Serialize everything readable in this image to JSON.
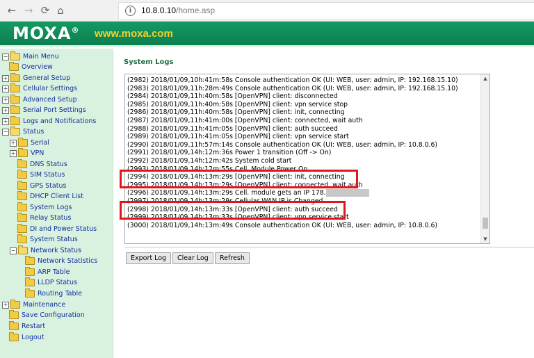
{
  "browser": {
    "back_icon": "←",
    "forward_icon": "→",
    "reload_icon": "⟳",
    "home_icon": "⌂",
    "info_icon": "i",
    "url_host": "10.8.0.10",
    "url_path": "/home.asp"
  },
  "header": {
    "logo": "MOXA",
    "logo_mark": "®",
    "site": "www.moxa.com"
  },
  "sidebar": {
    "items": [
      {
        "label": "Main Menu",
        "expander": "−"
      },
      {
        "label": "Overview",
        "expander": ""
      },
      {
        "label": "General Setup",
        "expander": "+"
      },
      {
        "label": "Cellular Settings",
        "expander": "+"
      },
      {
        "label": "Advanced Setup",
        "expander": "+"
      },
      {
        "label": "Serial Port Settings",
        "expander": "+"
      },
      {
        "label": "Logs and Notifications",
        "expander": "+"
      },
      {
        "label": "Status",
        "expander": "−"
      },
      {
        "label": "Serial",
        "expander": "+"
      },
      {
        "label": "VPN",
        "expander": "+"
      },
      {
        "label": "DNS Status",
        "expander": ""
      },
      {
        "label": "SIM Status",
        "expander": ""
      },
      {
        "label": "GPS Status",
        "expander": ""
      },
      {
        "label": "DHCP Client List",
        "expander": ""
      },
      {
        "label": "System Logs",
        "expander": ""
      },
      {
        "label": "Relay Status",
        "expander": ""
      },
      {
        "label": "DI and Power Status",
        "expander": ""
      },
      {
        "label": "System Status",
        "expander": ""
      },
      {
        "label": "Network Status",
        "expander": "−"
      },
      {
        "label": "Network Statistics",
        "expander": ""
      },
      {
        "label": "ARP Table",
        "expander": ""
      },
      {
        "label": "LLDP Status",
        "expander": ""
      },
      {
        "label": "Routing Table",
        "expander": ""
      },
      {
        "label": "Maintenance",
        "expander": "+"
      },
      {
        "label": "Save Configuration",
        "expander": ""
      },
      {
        "label": "Restart",
        "expander": ""
      },
      {
        "label": "Logout",
        "expander": ""
      }
    ]
  },
  "main": {
    "title": "System Logs",
    "log_lines": [
      "(2982) 2018/01/09,10h:41m:58s Console authentication OK (UI: WEB, user: admin, IP: 192.168.15.10)",
      "(2983) 2018/01/09,11h:28m:49s Console authentication OK (UI: WEB, user: admin, IP: 192.168.15.10)",
      "(2984) 2018/01/09,11h:40m:58s [OpenVPN] client: disconnected",
      "(2985) 2018/01/09,11h:40m:58s [OpenVPN] client: vpn service stop",
      "(2986) 2018/01/09,11h:40m:58s [OpenVPN] client: init, connecting",
      "(2987) 2018/01/09,11h:41m:00s [OpenVPN] client: connected, wait auth",
      "(2988) 2018/01/09,11h:41m:05s [OpenVPN] client: auth succeed",
      "(2989) 2018/01/09,11h:41m:05s [OpenVPN] client: vpn service start",
      "(2990) 2018/01/09,11h:57m:14s Console authentication OK (UI: WEB, user: admin, IP: 10.8.0.6)",
      "(2991) 2018/01/09,14h:12m:36s Power 1 transition (Off -> On)",
      "(2992) 2018/01/09,14h:12m:42s System cold start",
      "(2993) 2018/01/09,14h:12m:55s Cell. Module Power On",
      "(2994) 2018/01/09,14h:13m:29s [OpenVPN] client: init, connecting",
      "(2995) 2018/01/09,14h:13m:29s [OpenVPN] client: connected, wait auth",
      "(2996) 2018/01/09,14h:13m:29s Cell. module gets an IP 178.",
      "(2997) 2018/01/09,14h:13m:29s Cellular WAN IP is Changed",
      "(2998) 2018/01/09,14h:13m:33s [OpenVPN] client: auth succeed",
      "(2999) 2018/01/09,14h:13m:33s [OpenVPN] client: vpn service start",
      "(3000) 2018/01/09,14h:13m:49s Console authentication OK (UI: WEB, user: admin, IP: 10.8.0.6)"
    ],
    "scroll_up": "▲",
    "scroll_down": "▼",
    "buttons": {
      "export": "Export Log",
      "clear": "Clear Log",
      "refresh": "Refresh"
    },
    "highlight_color": "#e0161c"
  }
}
